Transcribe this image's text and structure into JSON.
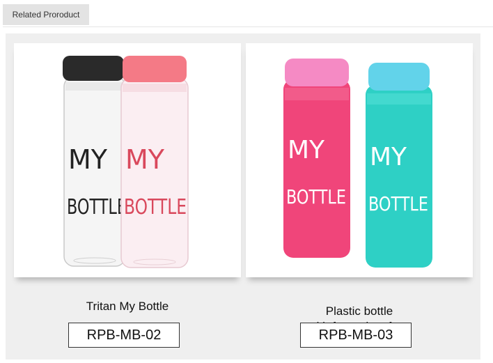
{
  "tab": {
    "label": "Related Proroduct"
  },
  "products": [
    {
      "name": "Tritan My Bottle",
      "code": "RPB-MB-02",
      "image": {
        "bottles": [
          {
            "print": [
              "MY",
              "BOTTLE"
            ],
            "cap_color": "#2a2a2a",
            "print_color": "#222222",
            "body": "clear"
          },
          {
            "print": [
              "MY",
              "BOTTLE"
            ],
            "cap_color": "#f47a86",
            "print_color": "#d9485c",
            "body": "clear-pink"
          }
        ]
      }
    },
    {
      "name": "Plastic bottle\nwith frosted surface",
      "code": "RPB-MB-03",
      "image": {
        "bottles": [
          {
            "print": [
              "MY",
              "BOTTLE"
            ],
            "cap_color": "#f58ac4",
            "body_color": "#f0457a",
            "print_color": "#ffffff"
          },
          {
            "print": [
              "MY",
              "BOTTLE"
            ],
            "cap_color": "#62d3ea",
            "body_color": "#2ed0c5",
            "print_color": "#ffffff"
          }
        ]
      }
    }
  ]
}
